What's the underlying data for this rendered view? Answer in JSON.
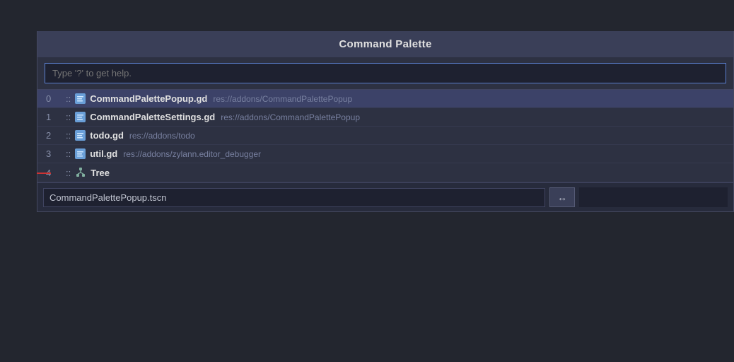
{
  "dialog": {
    "title": "Command Palette",
    "search": {
      "placeholder": "Type '?' to get help.",
      "value": ""
    },
    "results": [
      {
        "index": "0",
        "separator": "::",
        "icon_type": "script",
        "name": "CommandPalettePopup.gd",
        "path": "res://addons/CommandPalettePopup",
        "selected": true
      },
      {
        "index": "1",
        "separator": "::",
        "icon_type": "script",
        "name": "CommandPaletteSettings.gd",
        "path": "res://addons/CommandPalettePopup",
        "selected": false
      },
      {
        "index": "2",
        "separator": "::",
        "icon_type": "script",
        "name": "todo.gd",
        "path": "res://addons/todo",
        "selected": false
      },
      {
        "index": "3",
        "separator": "::",
        "icon_type": "script",
        "name": "util.gd",
        "path": "res://addons/zylann.editor_debugger",
        "selected": false
      },
      {
        "index": "4",
        "separator": "::",
        "icon_type": "tree",
        "name": "Tree",
        "path": "",
        "selected": false
      }
    ],
    "footer": {
      "input_value": "CommandPalettePopup.tscn",
      "arrow_label": "↔"
    }
  }
}
